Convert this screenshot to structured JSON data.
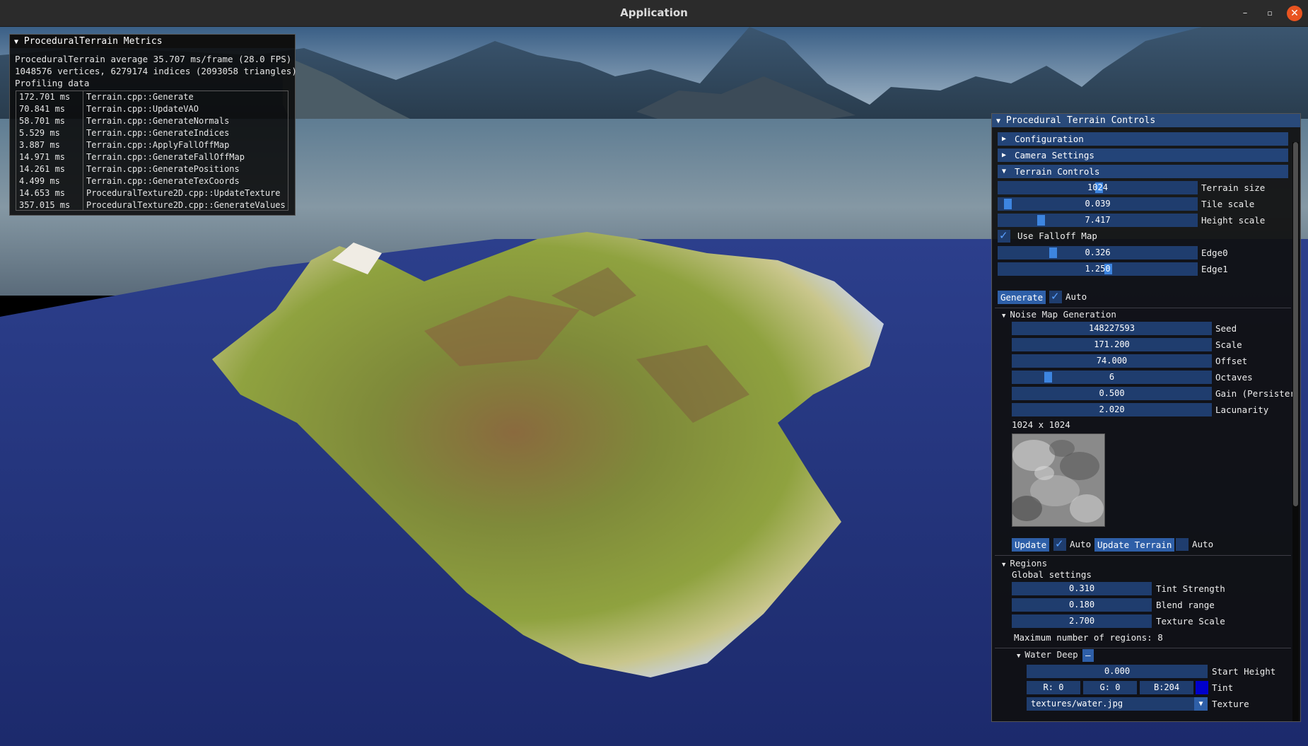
{
  "window": {
    "title": "Application"
  },
  "window_buttons": {
    "minimize": "–",
    "maximize": "▫",
    "close": "✕"
  },
  "metrics": {
    "title": "ProceduralTerrain Metrics",
    "average_line": "ProceduralTerrain average 35.707 ms/frame (28.0 FPS)",
    "vertex_line": "1048576 vertices, 6279174 indices (2093058 triangles)",
    "profiling_label": "Profiling data",
    "rows": [
      {
        "time": "172.701 ms",
        "name": "Terrain.cpp::Generate"
      },
      {
        "time": "70.841 ms",
        "name": "Terrain.cpp::UpdateVAO"
      },
      {
        "time": "58.701 ms",
        "name": "Terrain.cpp::GenerateNormals"
      },
      {
        "time": "5.529 ms",
        "name": "Terrain.cpp::GenerateIndices"
      },
      {
        "time": "3.887 ms",
        "name": "Terrain.cpp::ApplyFallOffMap"
      },
      {
        "time": "14.971 ms",
        "name": "Terrain.cpp::GenerateFallOffMap"
      },
      {
        "time": "14.261 ms",
        "name": "Terrain.cpp::GeneratePositions"
      },
      {
        "time": "4.499 ms",
        "name": "Terrain.cpp::GenerateTexCoords"
      },
      {
        "time": "14.653 ms",
        "name": "ProceduralTexture2D.cpp::UpdateTexture"
      },
      {
        "time": "357.015 ms",
        "name": "ProceduralTexture2D.cpp::GenerateValues"
      }
    ]
  },
  "controls": {
    "title": "Procedural Terrain Controls",
    "headers": {
      "configuration": "Configuration",
      "camera_settings": "Camera Settings",
      "terrain_controls": "Terrain Controls"
    },
    "terrain": {
      "size": {
        "value": "1024",
        "label": "Terrain size",
        "level": 0.49
      },
      "tile_scale": {
        "value": "0.039",
        "label": "Tile scale",
        "level": 0.03
      },
      "height_scale": {
        "value": "7.417",
        "label": "Height scale",
        "level": 0.22
      },
      "use_falloff": {
        "label": "Use Falloff Map",
        "checked": true
      },
      "edge0": {
        "value": "0.326",
        "label": "Edge0",
        "level": 0.27
      },
      "edge1": {
        "value": "1.250",
        "label": "Edge1",
        "level": 0.54
      },
      "generate_button": "Generate",
      "auto_label": "Auto",
      "auto_checked": true
    },
    "noise": {
      "header": "Noise Map Generation",
      "seed": {
        "value": "148227593",
        "label": "Seed"
      },
      "scale": {
        "value": "171.200",
        "label": "Scale"
      },
      "offset": {
        "value": "74.000",
        "label": "Offset"
      },
      "octaves": {
        "value": "6",
        "label": "Octaves",
        "level": 0.17
      },
      "gain": {
        "value": "0.500",
        "label": "Gain (Persister"
      },
      "lacunarity": {
        "value": "2.020",
        "label": "Lacunarity"
      },
      "dimensions": "1024 x 1024",
      "update_button": "Update",
      "auto_label": "Auto",
      "auto_checked": true,
      "update_terrain_button": "Update Terrain",
      "auto2_label": "Auto",
      "auto2_checked": false
    },
    "regions": {
      "header": "Regions",
      "global_label": "Global settings",
      "tint_strength": {
        "value": "0.310",
        "label": "Tint Strength"
      },
      "blend_range": {
        "value": "0.180",
        "label": "Blend range"
      },
      "texture_scale": {
        "value": "2.700",
        "label": "Texture Scale"
      },
      "max_regions": "Maximum number of regions:  8",
      "water_deep": {
        "header": "Water Deep",
        "remove_button": "–",
        "start_height": {
          "value": "0.000",
          "label": "Start Height"
        },
        "r": "R:  0",
        "g": "G:  0",
        "b": "B:204",
        "tint_label": "Tint",
        "tint_color": "#0000cc",
        "texture_value": "textures/water.jpg",
        "texture_label": "Texture"
      }
    }
  }
}
